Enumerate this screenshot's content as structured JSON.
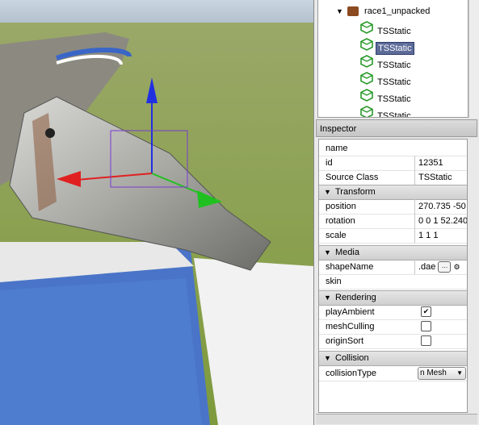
{
  "tree": {
    "root": {
      "label": "race1_unpacked"
    },
    "items": [
      {
        "label": "TSStatic",
        "selected": false
      },
      {
        "label": "TSStatic",
        "selected": true
      },
      {
        "label": "TSStatic",
        "selected": false
      },
      {
        "label": "TSStatic",
        "selected": false
      },
      {
        "label": "TSStatic",
        "selected": false
      },
      {
        "label": "TSStatic",
        "selected": false
      }
    ]
  },
  "inspector": {
    "title": "Inspector",
    "general": [
      {
        "name": "name",
        "value": ""
      },
      {
        "name": "id",
        "value": "12351"
      },
      {
        "name": "Source Class",
        "value": "TSStatic"
      }
    ],
    "categories": {
      "transform": "Transform",
      "media": "Media",
      "rendering": "Rendering",
      "collision": "Collision"
    },
    "transform": [
      {
        "name": "position",
        "value": "270.735 -50"
      },
      {
        "name": "rotation",
        "value": "0 0 1 52.240"
      },
      {
        "name": "scale",
        "value": "1 1 1"
      }
    ],
    "media": {
      "shapeName": {
        "name": "shapeName",
        "value": ".dae"
      },
      "skin": {
        "name": "skin",
        "value": ""
      }
    },
    "rendering": [
      {
        "name": "playAmbient",
        "checked": true
      },
      {
        "name": "meshCulling",
        "checked": false
      },
      {
        "name": "originSort",
        "checked": false
      }
    ],
    "collision": {
      "collisionType": {
        "name": "collisionType",
        "value": "n Mesh"
      }
    }
  },
  "icons": {
    "tree_expand": "triangle-down-icon",
    "object_icon": "green-cube-icon",
    "checkmark": "✔"
  },
  "colors": {
    "selection": "#5d6b99",
    "gizmo_x": "#e02020",
    "gizmo_y": "#20c020",
    "gizmo_z": "#2030e0"
  }
}
